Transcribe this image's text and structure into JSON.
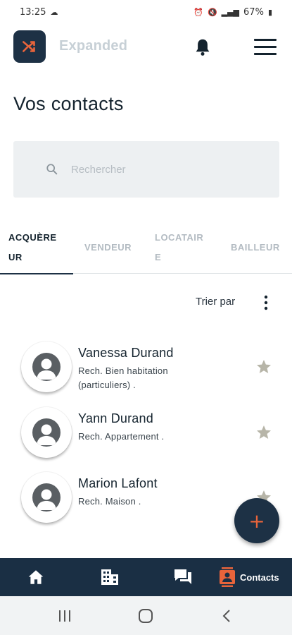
{
  "status_bar": {
    "time": "13:25",
    "battery": "67%"
  },
  "app_bar": {
    "title": "Expanded",
    "icons": [
      "shuffle-icon",
      "bell-icon",
      "hamburger-menu-icon"
    ]
  },
  "page": {
    "title": "Vos contacts"
  },
  "search": {
    "placeholder": "Rechercher",
    "value": ""
  },
  "tabs": [
    {
      "line1": "ACQUÈRE",
      "line2": "UR",
      "active": true
    },
    {
      "line1": "VENDEUR",
      "line2": "",
      "active": false
    },
    {
      "line1": "LOCATAIR",
      "line2": "E",
      "active": false
    },
    {
      "line1": "BAILLEUR",
      "line2": "",
      "active": false
    }
  ],
  "sort": {
    "label": "Trier par"
  },
  "contacts": [
    {
      "name": "Vanessa Durand",
      "description": "Rech. Bien habitation (particuliers) ."
    },
    {
      "name": "Yann Durand",
      "description": "Rech. Appartement ."
    },
    {
      "name": "Marion Lafont",
      "description": "Rech. Maison ."
    }
  ],
  "fab": {
    "label": "+"
  },
  "bottom_nav": [
    {
      "icon": "home-icon",
      "label": ""
    },
    {
      "icon": "building-icon",
      "label": ""
    },
    {
      "icon": "chat-icon",
      "label": ""
    },
    {
      "icon": "contacts-icon",
      "label": "Contacts",
      "active": true
    }
  ],
  "colors": {
    "primary": "#1d3145",
    "accent": "#e8643b",
    "bottom_nav_bg": "#1a2f44",
    "search_bg": "#edf0f2",
    "star": "#b7b5a8"
  }
}
